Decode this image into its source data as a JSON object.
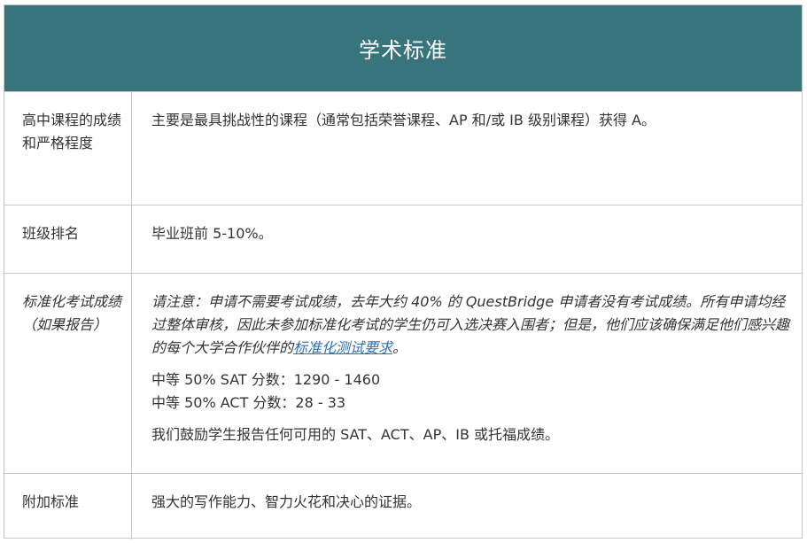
{
  "header": {
    "title": "学术标准"
  },
  "rows": [
    {
      "label": "高中课程的成绩和严格程度",
      "content": "主要是最具挑战性的课程（通常包括荣誉课程、AP 和/或 IB 级别课程）获得 A。"
    },
    {
      "label": "班级排名",
      "content": "毕业班前 5-10%。"
    },
    {
      "label": "标准化考试成绩（如果报告）",
      "note_text": "请注意：申请不需要考试成绩，去年大约 40% 的 QuestBridge 申请者没有考试成绩。所有申请均经过整体审核，因此未参加标准化考试的学生仍可入选决赛入围者；但是，他们应该确保满足他们感兴趣的每个大学合作伙伴的",
      "note_link": "标准化测试要求",
      "note_end": "。",
      "sat": "中等 50% SAT 分数：1290 - 1460",
      "act": "中等 50% ACT 分数：28 - 33",
      "encourage": "我们鼓励学生报告任何可用的 SAT、ACT、AP、IB 或托福成绩。"
    },
    {
      "label": "附加标准",
      "content": "强大的写作能力、智力火花和决心的证据。"
    }
  ]
}
